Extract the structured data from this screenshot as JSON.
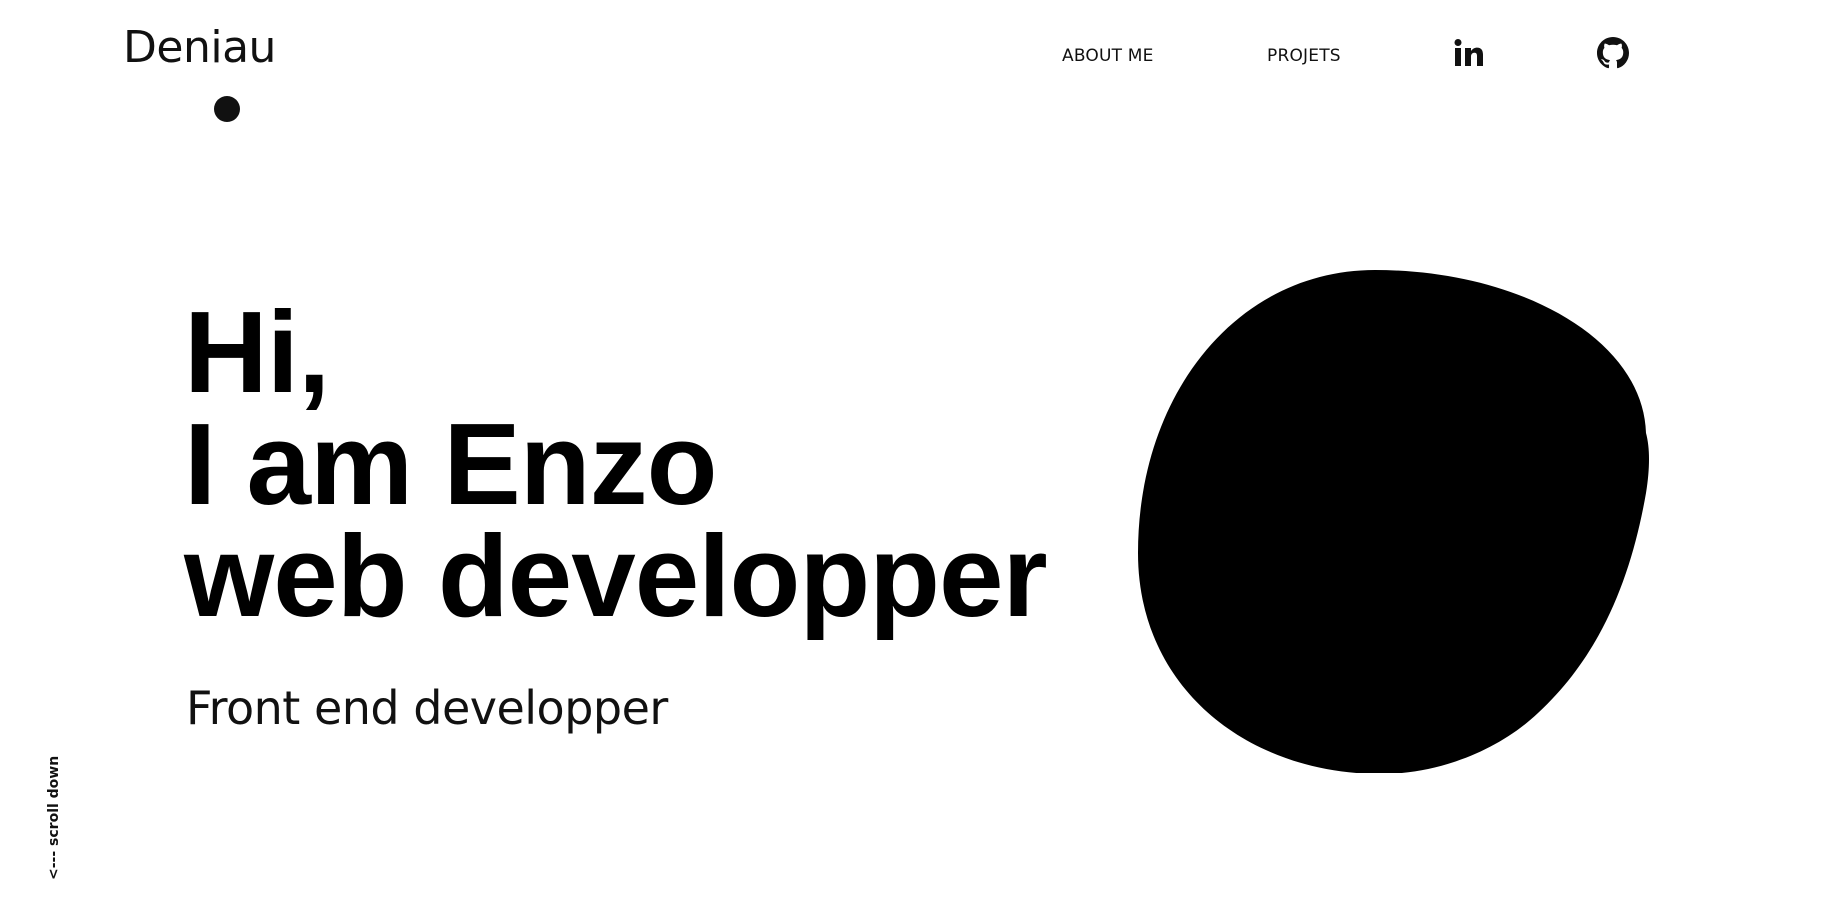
{
  "header": {
    "logo": "Deniau",
    "nav": {
      "about_label": "ABOUT ME",
      "projects_label": "PROJETS"
    },
    "social": {
      "linkedin_icon": "linkedin-icon",
      "github_icon": "github-icon"
    }
  },
  "hero": {
    "title_lines": [
      "Hi,",
      "I am Enzo",
      "web developper"
    ],
    "subtitle": "Front end developper",
    "blob_color": "#000000"
  },
  "scroll_hint": "<--- scroll down",
  "colors": {
    "background": "#ffffff",
    "text": "#000000"
  }
}
